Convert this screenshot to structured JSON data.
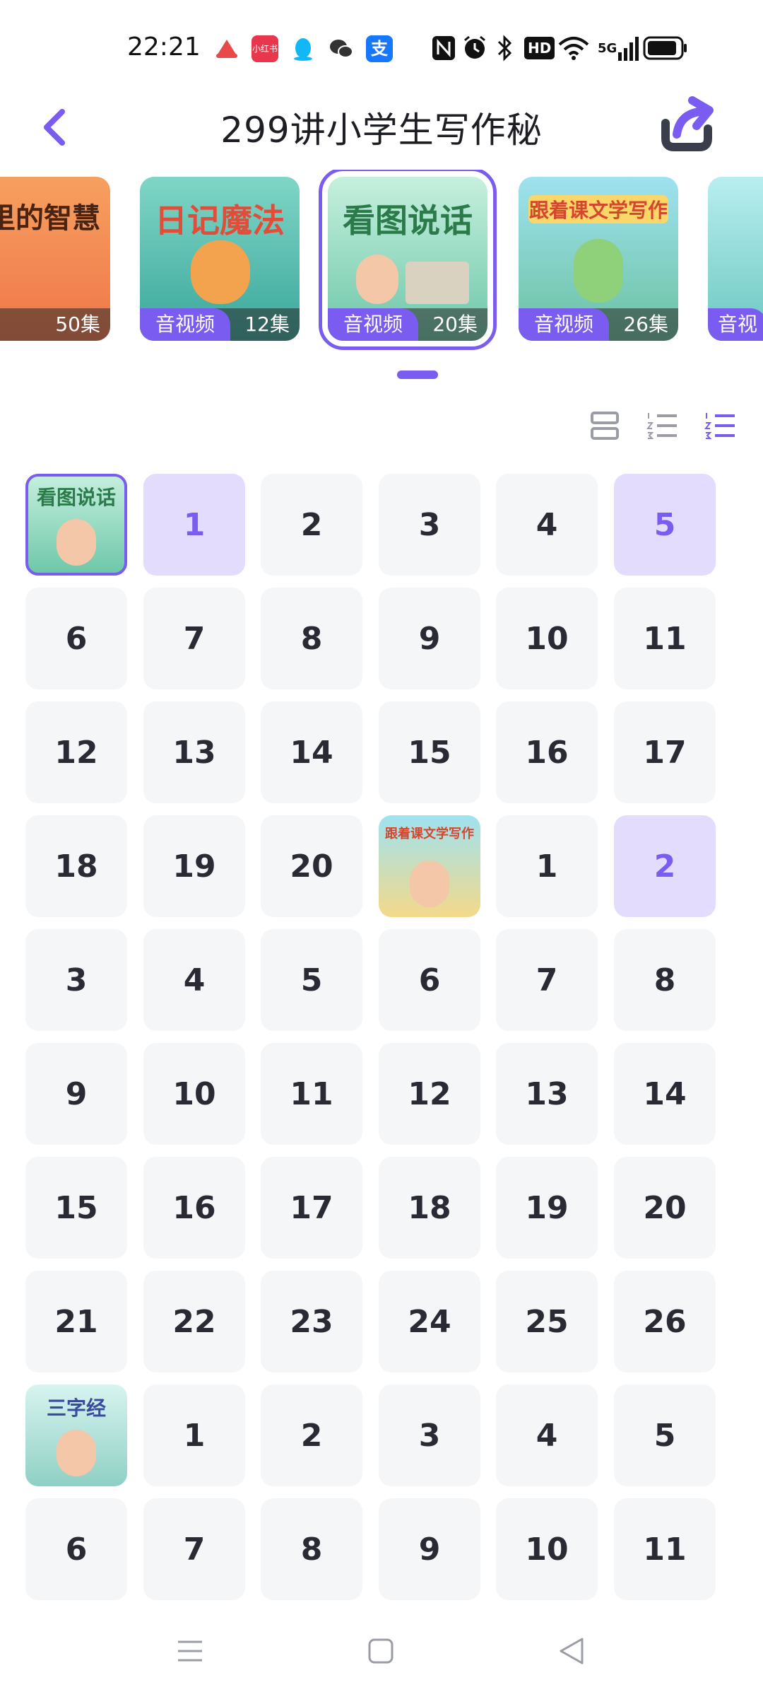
{
  "status_bar": {
    "time": "22:21",
    "app_icons": [
      {
        "name": "cake-app-icon",
        "color": "#e84a4a"
      },
      {
        "name": "xiaohongshu-icon",
        "color": "#e8374d",
        "label": "小红书"
      },
      {
        "name": "qq-icon",
        "color": "#12b7f5"
      },
      {
        "name": "wechat-icon",
        "color": "#333333"
      },
      {
        "name": "alipay-icon",
        "color": "#1677ff",
        "label": "支"
      }
    ],
    "network_label": "5G",
    "hd_label": "HD"
  },
  "header": {
    "title": "299讲小学生写作秘"
  },
  "carousel": {
    "cards": [
      {
        "title": "嘉里的智慧",
        "type": "",
        "count": "50集",
        "bg": "#f08a5d"
      },
      {
        "title": "日记魔法",
        "type": "音视频",
        "count": "12集",
        "bg": "#6ed0c4"
      },
      {
        "title": "看图说话",
        "type": "音视频",
        "count": "20集",
        "bg": "#8fdcc0",
        "selected": true
      },
      {
        "title": "跟着课文学写作",
        "type": "音视频",
        "count": "26集",
        "bg": "#7ed6e8"
      },
      {
        "title": "",
        "type": "音视",
        "count": "",
        "bg": "#a8e6ea"
      }
    ]
  },
  "colors": {
    "accent": "#7a5cf0",
    "cell_bg": "#f5f6f8",
    "cell_highlight": "#e4dcfd"
  },
  "grid": {
    "rows": [
      [
        {
          "thumb": "看图说话",
          "selected": true
        },
        {
          "n": "1",
          "hl": true
        },
        {
          "n": "2"
        },
        {
          "n": "3"
        },
        {
          "n": "4"
        },
        {
          "n": "5",
          "hl": true
        }
      ],
      [
        {
          "n": "6"
        },
        {
          "n": "7"
        },
        {
          "n": "8"
        },
        {
          "n": "9"
        },
        {
          "n": "10"
        },
        {
          "n": "11"
        }
      ],
      [
        {
          "n": "12"
        },
        {
          "n": "13"
        },
        {
          "n": "14"
        },
        {
          "n": "15"
        },
        {
          "n": "16"
        },
        {
          "n": "17"
        }
      ],
      [
        {
          "n": "18"
        },
        {
          "n": "19"
        },
        {
          "n": "20"
        },
        {
          "thumb": "跟着课文学写作"
        },
        {
          "n": "1"
        },
        {
          "n": "2",
          "hl": true
        }
      ],
      [
        {
          "n": "3"
        },
        {
          "n": "4"
        },
        {
          "n": "5"
        },
        {
          "n": "6"
        },
        {
          "n": "7"
        },
        {
          "n": "8"
        }
      ],
      [
        {
          "n": "9"
        },
        {
          "n": "10"
        },
        {
          "n": "11"
        },
        {
          "n": "12"
        },
        {
          "n": "13"
        },
        {
          "n": "14"
        }
      ],
      [
        {
          "n": "15"
        },
        {
          "n": "16"
        },
        {
          "n": "17"
        },
        {
          "n": "18"
        },
        {
          "n": "19"
        },
        {
          "n": "20"
        }
      ],
      [
        {
          "n": "21"
        },
        {
          "n": "22"
        },
        {
          "n": "23"
        },
        {
          "n": "24"
        },
        {
          "n": "25"
        },
        {
          "n": "26"
        }
      ],
      [
        {
          "thumb": "三字经"
        },
        {
          "n": "1"
        },
        {
          "n": "2"
        },
        {
          "n": "3"
        },
        {
          "n": "4"
        },
        {
          "n": "5"
        }
      ],
      [
        {
          "n": "6"
        },
        {
          "n": "7"
        },
        {
          "n": "8"
        },
        {
          "n": "9"
        },
        {
          "n": "10"
        },
        {
          "n": "11"
        }
      ]
    ]
  }
}
